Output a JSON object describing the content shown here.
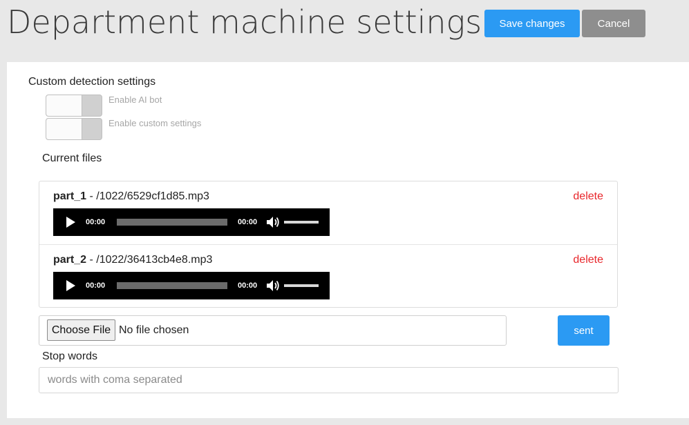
{
  "header": {
    "title": "Department machine settings",
    "save_label": "Save changes",
    "cancel_label": "Cancel"
  },
  "detection": {
    "section_title": "Custom detection settings",
    "toggles": [
      {
        "label": "Enable AI bot",
        "on": false
      },
      {
        "label": "Enable custom settings",
        "on": false
      }
    ]
  },
  "files": {
    "section_title": "Current files",
    "items": [
      {
        "name": "part_1",
        "path": " - /1022/6529cf1d85.mp3",
        "delete_label": "delete",
        "current_time": "00:00",
        "duration": "00:00"
      },
      {
        "name": "part_2",
        "path": " - /1022/36413cb4e8.mp3",
        "delete_label": "delete",
        "current_time": "00:00",
        "duration": "00:00"
      }
    ],
    "upload": {
      "choose_label": "Choose File",
      "status": "No file chosen",
      "sent_label": "sent"
    }
  },
  "stop_words": {
    "label": "Stop words",
    "placeholder": "words with coma separated",
    "value": ""
  },
  "colors": {
    "primary": "#2b9af3",
    "secondary": "#8e8e8e",
    "danger": "#e8262b"
  }
}
